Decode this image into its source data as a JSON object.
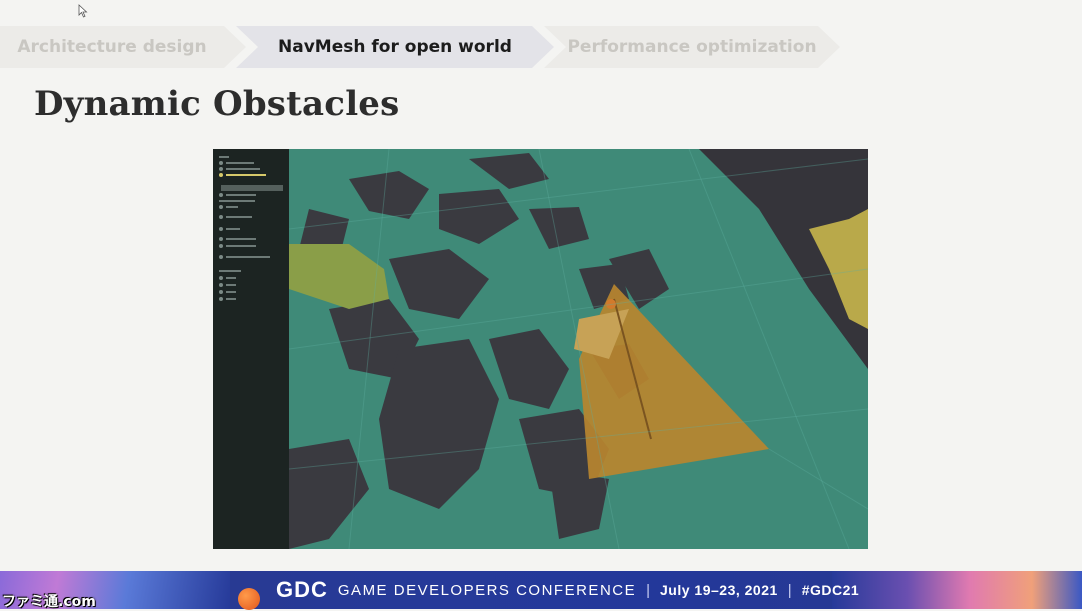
{
  "breadcrumb": {
    "items": [
      {
        "label": "Architecture design",
        "state": "inactive"
      },
      {
        "label": "NavMesh for open world",
        "state": "active"
      },
      {
        "label": "Performance optimization",
        "state": "inactive"
      }
    ]
  },
  "slide": {
    "title": "Dynamic Obstacles"
  },
  "footer": {
    "logo": "GDC",
    "conference": "GAME DEVELOPERS CONFERENCE",
    "separator": "|",
    "dates": "July 19–23, 2021",
    "hashtag": "#GDC21"
  },
  "watermark": "ファミ通.com",
  "colors": {
    "navmesh_teal": "#3d8a78",
    "obstacle_orange": "#b8862f",
    "walkable_green": "#8a9e48",
    "terrain_dark": "#35343a",
    "footer_blue": "#263a99"
  }
}
